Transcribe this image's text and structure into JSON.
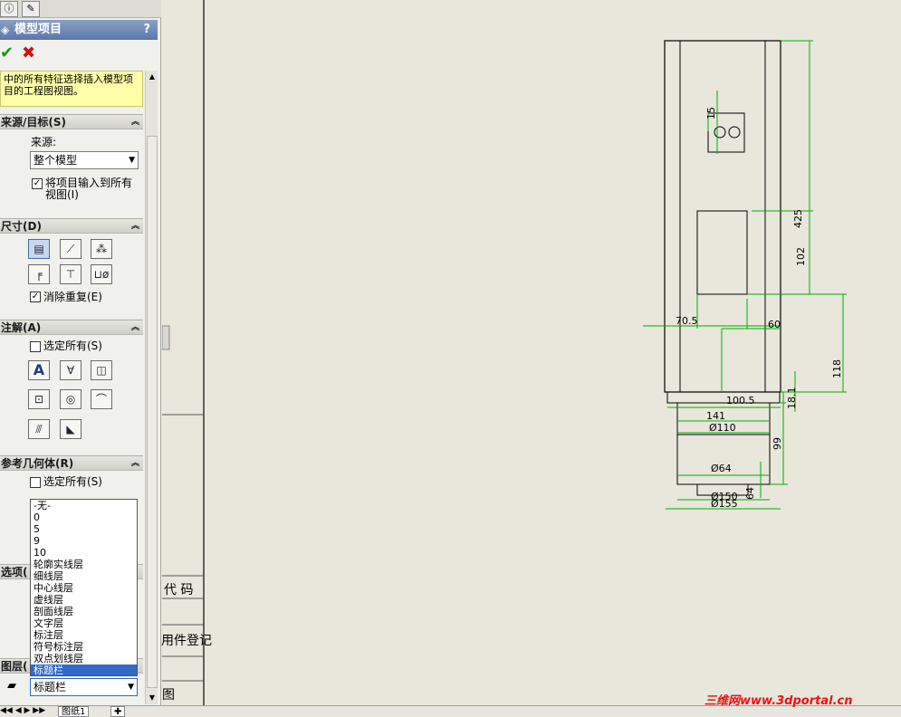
{
  "top_tabs": [
    "ⓘ",
    "✎"
  ],
  "panel": {
    "title": "模型项目",
    "help": "?",
    "ok": "✔",
    "cancel": "✖",
    "message": "中的所有特征选择插入模型项目的工程图视图。"
  },
  "source_section": {
    "header": "来源/目标(S)",
    "source_label": "来源:",
    "source_value": "整个模型",
    "import_all_views": "将项目输入到所有视图(I)",
    "import_all_checked": true
  },
  "dimension_section": {
    "header": "尺寸(D)",
    "tools": [
      "marked-for-drawing",
      "not-marked",
      "instance-count",
      "tolerance",
      "hole-wizard",
      "location"
    ],
    "eliminate_duplicates": "消除重复(E)",
    "eliminate_checked": true
  },
  "annotation_section": {
    "header": "注解(A)",
    "select_all": "选定所有(S)",
    "select_all_checked": false
  },
  "reference_section": {
    "header": "参考几何体(R)",
    "select_all": "选定所有(S)",
    "select_all_checked": false
  },
  "options_section": {
    "header": "选项("
  },
  "layer_section": {
    "header": "图层(",
    "value": "标题栏",
    "options": [
      "-无-",
      "0",
      "5",
      "9",
      "10",
      "轮廓实线层",
      "细线层",
      "中心线层",
      "虚线层",
      "剖面线层",
      "文字层",
      "标注层",
      "符号标注层",
      "双点划线层",
      "标题栏"
    ],
    "selected_index": 14
  },
  "sheet_tab": "图纸1",
  "title_block": {
    "code": "代 码",
    "register": "用件登记",
    "drawing": "图"
  },
  "dimensions": {
    "d425": "425",
    "d102": "102",
    "d118": "118",
    "d70_5": "70.5",
    "d60": "60",
    "d100_5": "100.5",
    "d18_1": "18.1",
    "d141": "141",
    "d110": "Ø110",
    "d99": "99",
    "d64": "Ø64",
    "d150": "Ø150",
    "d155": "Ø155",
    "d64v": "64",
    "d15": "15"
  },
  "watermark": "三维网www.3dportal.cn",
  "colors": {
    "dimension": "#00b000",
    "paper": "#e9e6dc",
    "title_bar": "#5b77a8"
  }
}
